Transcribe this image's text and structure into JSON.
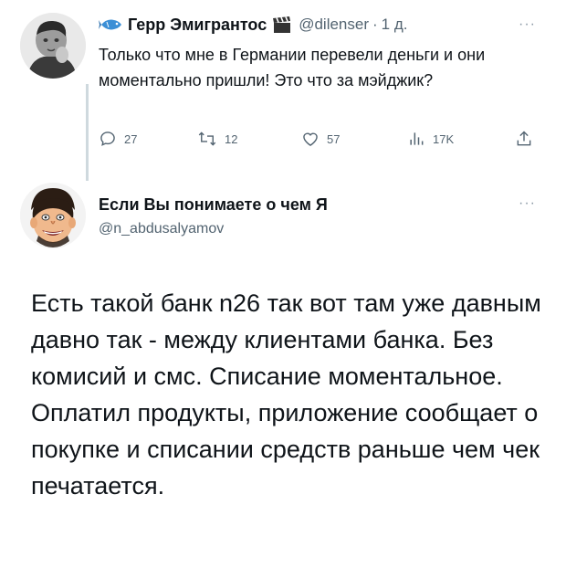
{
  "tweet1": {
    "author_name": "Герр Эмигрантос",
    "handle": "@dilenser",
    "separator": "·",
    "time": "1 д.",
    "more": "···",
    "text": "Только что мне в Германии перевели деньги и они моментально пришли! Это что за мэйджик?",
    "actions": {
      "replies": "27",
      "retweets": "12",
      "likes": "57",
      "views": "17K"
    },
    "icons": [
      "fish-icon",
      "clapperboard-icon",
      "reply-icon",
      "retweet-icon",
      "like-icon",
      "views-icon",
      "share-icon"
    ]
  },
  "tweet2": {
    "author_name": "Если Вы понимаете о чем Я",
    "handle": "@n_abdusalyamov",
    "more": "···",
    "text": "Есть такой банк n26 так вот там уже давным давно так - между клиентами банка. Без комисий и смс. Списание моментальное. Оплатил продукты, приложение сообщает о покупке и списании средств раньше чем чек печатается."
  },
  "colors": {
    "text": "#0f1419",
    "secondary": "#536471",
    "thread_line": "#cfd9de"
  }
}
